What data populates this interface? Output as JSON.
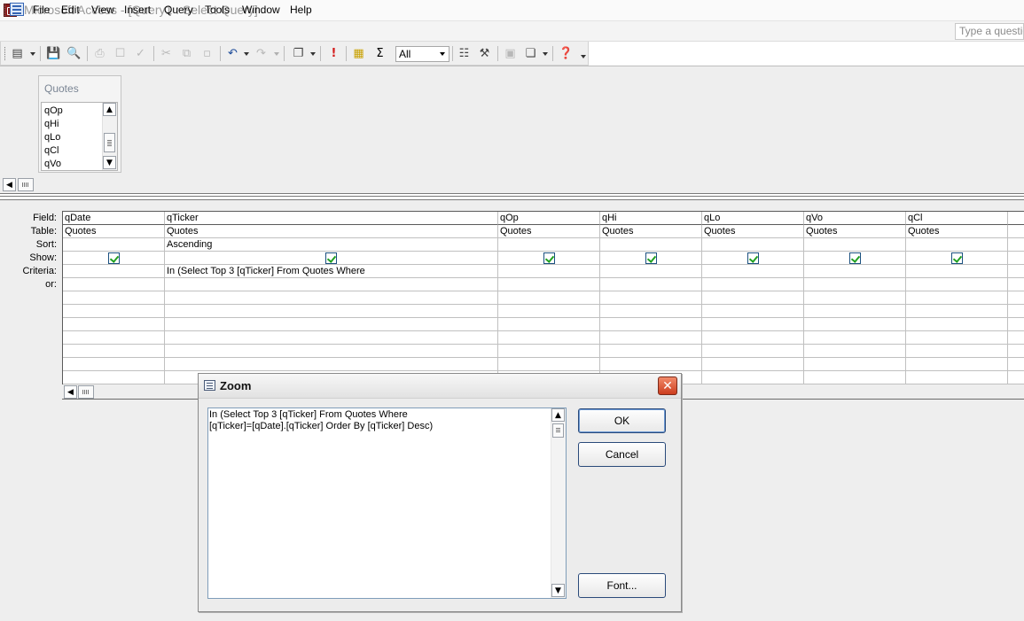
{
  "window": {
    "title": "Microsoft Access - [Query1 : Select Query]"
  },
  "menu": {
    "items": [
      "File",
      "Edit",
      "View",
      "Insert",
      "Query",
      "Tools",
      "Window",
      "Help"
    ],
    "question_placeholder": "Type a question"
  },
  "toolbar": {
    "query_type_combo": "All",
    "icons": [
      "view-icon",
      "save-icon",
      "file-search-icon",
      "print-icon",
      "print-preview-icon",
      "spelling-icon",
      "cut-icon",
      "copy-icon",
      "paste-icon",
      "undo-icon",
      "redo-icon",
      "query-type-icon",
      "run-icon",
      "show-table-icon",
      "totals-icon",
      "properties-icon",
      "build-icon",
      "database-window-icon",
      "new-object-icon",
      "help-icon"
    ]
  },
  "table_box": {
    "title": "Quotes",
    "fields": [
      "qOp",
      "qHi",
      "qLo",
      "qCl",
      "qVo"
    ]
  },
  "grid": {
    "row_labels": [
      "Field:",
      "Table:",
      "Sort:",
      "Show:",
      "Criteria:",
      "or:"
    ],
    "columns": [
      {
        "field": "qDate",
        "table": "Quotes",
        "sort": "",
        "show": true,
        "criteria": ""
      },
      {
        "field": "qTicker",
        "table": "Quotes",
        "sort": "Ascending",
        "show": true,
        "criteria": "In (Select Top 3 [qTicker] From Quotes Where"
      },
      {
        "field": "qOp",
        "table": "Quotes",
        "sort": "",
        "show": true,
        "criteria": ""
      },
      {
        "field": "qHi",
        "table": "Quotes",
        "sort": "",
        "show": true,
        "criteria": ""
      },
      {
        "field": "qLo",
        "table": "Quotes",
        "sort": "",
        "show": true,
        "criteria": ""
      },
      {
        "field": "qVo",
        "table": "Quotes",
        "sort": "",
        "show": true,
        "criteria": ""
      },
      {
        "field": "qCl",
        "table": "Quotes",
        "sort": "",
        "show": true,
        "criteria": ""
      }
    ]
  },
  "zoom": {
    "title": "Zoom",
    "text_line1": "In (Select Top 3 [qTicker] From Quotes Where",
    "text_line2": "[qTicker]=[qDate].[qTicker] Order By [qTicker] Desc)",
    "ok_label": "OK",
    "cancel_label": "Cancel",
    "font_label": "Font..."
  },
  "colors": {
    "checkbox_check": "#21a121",
    "dialog_border": "#2a4a7a",
    "close_button": "#cc3d1e"
  }
}
